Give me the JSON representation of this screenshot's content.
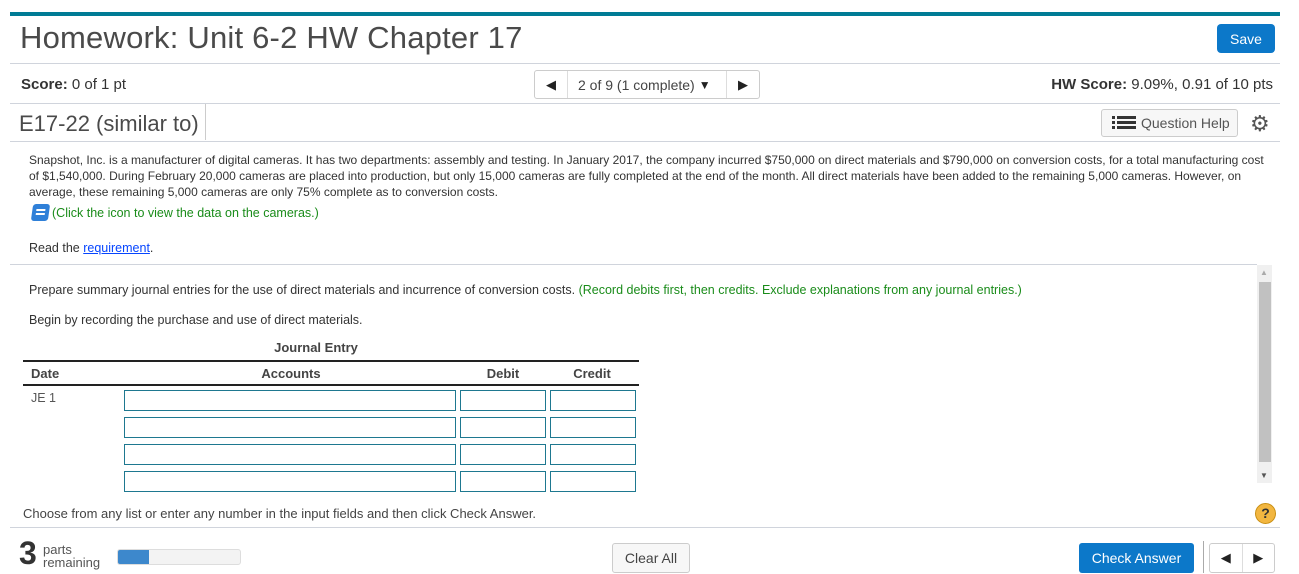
{
  "header": {
    "title": "Homework: Unit 6-2 HW Chapter 17",
    "save_label": "Save",
    "score_label": "Score:",
    "score_value": " 0 of 1 pt",
    "hw_score_label": "HW Score:",
    "hw_score_value": " 9.09%, 0.91 of 10 pts",
    "question_nav": {
      "prev_icon": "◀",
      "current": "2 of 9 (1 complete)",
      "caret_icon": "▼",
      "next_icon": "▶"
    }
  },
  "question": {
    "id": "E17-22 (similar to)",
    "help_label": "Question Help",
    "problem_text": "Snapshot, Inc. is a manufacturer of digital cameras. It has two departments: assembly and testing. In January 2017, the company incurred $750,000 on direct materials and $790,000 on conversion costs, for a total manufacturing cost of $1,540,000. During February 20,000 cameras are placed into production, but only 15,000 cameras are fully completed at the end of the month. All direct materials have been added to the remaining 5,000 cameras. However, on average, these remaining 5,000 cameras are only 75% complete as to conversion costs.",
    "data_link": "(Click the icon to view the data on the cameras.)",
    "read_prefix": "Read the ",
    "read_link": "requirement",
    "read_suffix": ".",
    "instruction": "Prepare summary journal entries for the use of direct materials and incurrence of conversion costs. ",
    "instruction_note": "(Record debits first, then credits. Exclude explanations from any journal entries.)",
    "begin_text": "Begin by recording the purchase and use of direct materials."
  },
  "journal": {
    "caption": "Journal Entry",
    "columns": [
      "Date",
      "Accounts",
      "Debit",
      "Credit"
    ],
    "rows": [
      {
        "date": "JE 1",
        "account": "",
        "debit": "",
        "credit": ""
      },
      {
        "date": "",
        "account": "",
        "debit": "",
        "credit": ""
      },
      {
        "date": "",
        "account": "",
        "debit": "",
        "credit": ""
      },
      {
        "date": "",
        "account": "",
        "debit": "",
        "credit": ""
      }
    ]
  },
  "footer": {
    "choose_text": "Choose from any list or enter any number in the input fields and then click Check Answer.",
    "help_icon": "?",
    "parts_count": "3",
    "parts_label_1": "parts",
    "parts_label_2": "remaining",
    "progress_fraction": 0.25,
    "clear_label": "Clear All",
    "check_label": "Check Answer",
    "prev_icon": "◀",
    "next_icon": "▶"
  },
  "colors": {
    "accent": "#007b95",
    "primary_button": "#0c78c9",
    "note_green": "#1a8c1a",
    "input_border": "#1e7890",
    "progress_fill": "#3d88cc"
  }
}
